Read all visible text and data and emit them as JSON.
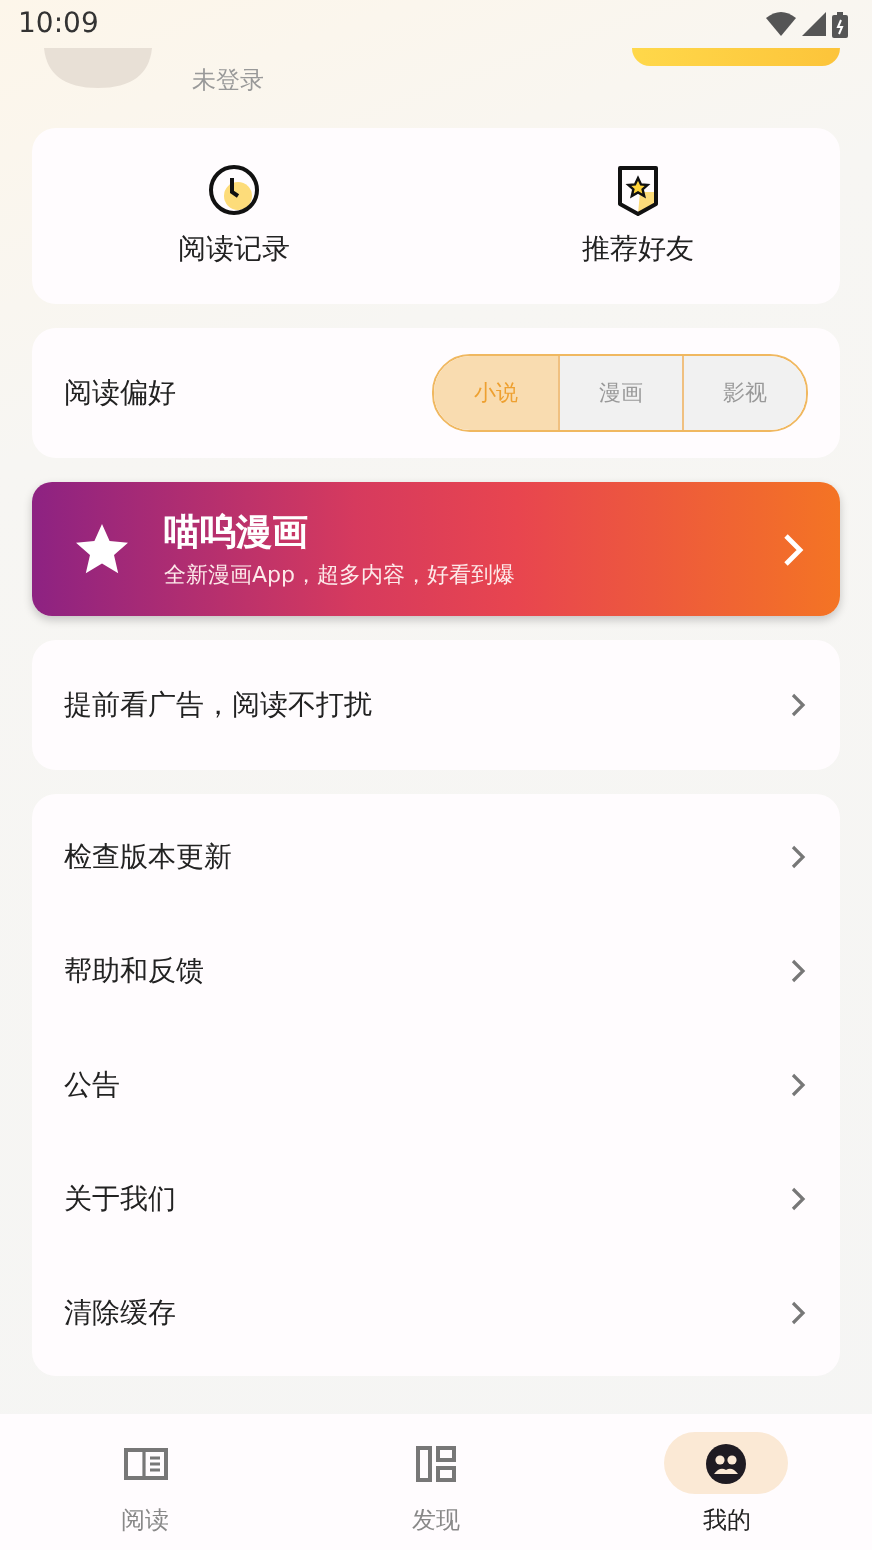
{
  "status_bar": {
    "time": "10:09"
  },
  "profile": {
    "login_status": "未登录"
  },
  "shortcuts": [
    {
      "label": "阅读记录",
      "kind": "clock"
    },
    {
      "label": "推荐好友",
      "kind": "badge"
    }
  ],
  "preference": {
    "label": "阅读偏好",
    "options": [
      {
        "label": "小说",
        "selected": true
      },
      {
        "label": "漫画",
        "selected": false
      },
      {
        "label": "影视",
        "selected": false
      }
    ]
  },
  "promo": {
    "title": "喵呜漫画",
    "subtitle": "全新漫画App，超多内容，好看到爆"
  },
  "ad_item": {
    "label": "提前看广告，阅读不打扰"
  },
  "menu_items": [
    {
      "label": "检查版本更新"
    },
    {
      "label": "帮助和反馈"
    },
    {
      "label": "公告"
    },
    {
      "label": "关于我们"
    },
    {
      "label": "清除缓存"
    }
  ],
  "bottom_nav": [
    {
      "label": "阅读",
      "kind": "book",
      "selected": false
    },
    {
      "label": "发现",
      "kind": "grid",
      "selected": false
    },
    {
      "label": "我的",
      "kind": "person",
      "selected": true
    }
  ]
}
